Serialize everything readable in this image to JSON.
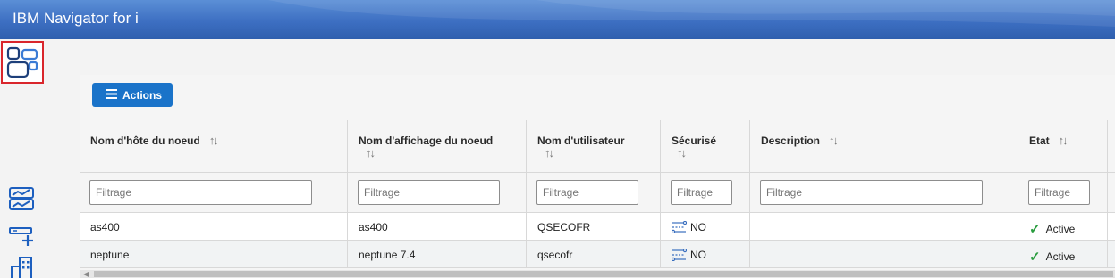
{
  "app": {
    "title": "IBM Navigator for i"
  },
  "toolbar": {
    "actions_label": "Actions"
  },
  "table": {
    "columns": [
      "Nom d'hôte du noeud",
      "Nom d'affichage du noeud",
      "Nom d'utilisateur",
      "Sécurisé",
      "Description",
      "Etat"
    ],
    "filter_placeholder": "Filtrage",
    "rows": [
      {
        "host": "as400",
        "display": "as400",
        "user": "QSECOFR",
        "secure": "NO",
        "description": "",
        "state": "Active"
      },
      {
        "host": "neptune",
        "display": "neptune 7.4",
        "user": "qsecofr",
        "secure": "NO",
        "description": "",
        "state": "Active"
      }
    ]
  },
  "colors": {
    "header_top": "#5b8fd6",
    "header_bottom": "#2f5fae",
    "accent": "#1a73c9",
    "selected_outline": "#d9262c",
    "active_green": "#2a9d3f"
  },
  "icons": {
    "rail": [
      "dashboard-icon",
      "performance-icon",
      "add-connection-icon",
      "system-building-icon"
    ],
    "sort": "sort-icon",
    "secure": "connection-icon",
    "state": "check-icon",
    "actions": "menu-icon"
  }
}
